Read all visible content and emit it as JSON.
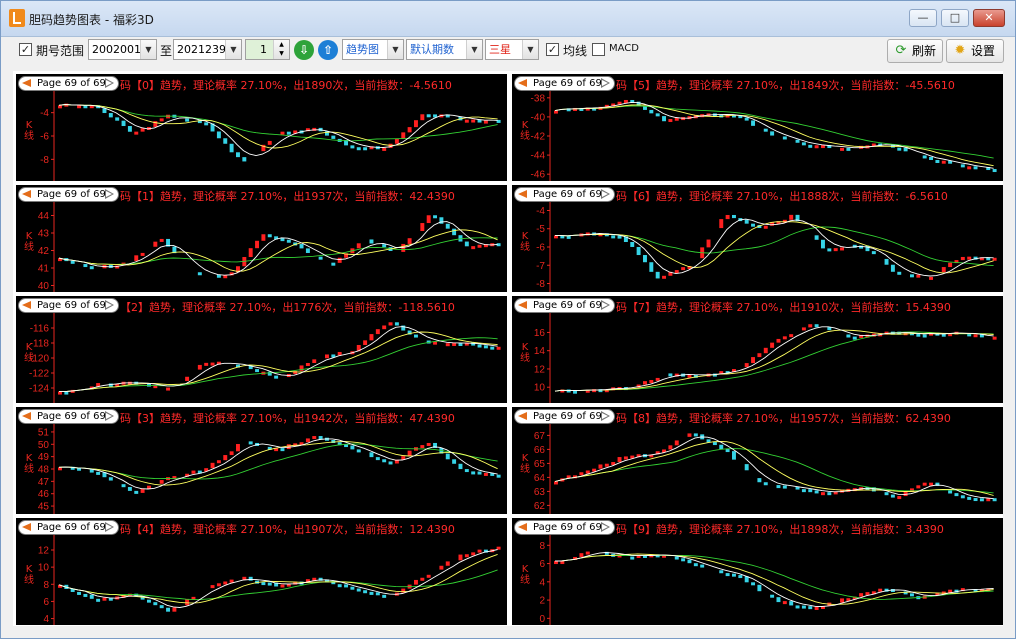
{
  "window": {
    "title": "胆码趋势图表 - 福彩3D",
    "min": "—",
    "max": "□",
    "close": "✕"
  },
  "toolbar": {
    "period_checkbox": "✓",
    "period_label": "期号范围",
    "from_value": "2002001",
    "to_label": "至",
    "to_value": "2021239",
    "step_value": "1",
    "chart_type": "趋势图",
    "period_mode": "默认期数",
    "lottery": "三星",
    "ma_checkbox": "✓",
    "ma_label": "均线",
    "macd_label": "MACD",
    "refresh_label": "刷新",
    "settings_label": "设置"
  },
  "colors": {
    "up": "#ff2020",
    "down": "#36d3e6",
    "ma5": "#ffffff",
    "ma10": "#ffff60",
    "ma20": "#33d033",
    "axis": "#e9261f"
  },
  "panels": [
    {
      "pager": "Page 69 of 69",
      "title": "码【0】趋势，理论概率 27.10%，出1890次，当前指数：-4.5610",
      "ylabel": "K线",
      "ticks": [
        "-4",
        "-6",
        "-8"
      ],
      "tickVals": [
        -4,
        -6,
        -8
      ],
      "ymin": -9.6,
      "ymax": -2.4,
      "start": -3.3,
      "end": -4.6,
      "mid": [
        -3.5,
        -5.8,
        -4.2,
        -5.0,
        -8.3,
        -5.6,
        -5.4,
        -7.0,
        -6.9,
        -4.0,
        -4.6
      ]
    },
    {
      "pager": "Page 69 of 69",
      "title": "码【5】趋势，理论概率 27.10%，出1849次，当前指数：-45.5610",
      "ylabel": "K线",
      "ticks": [
        "-38",
        "-40",
        "-42",
        "-44",
        "-46"
      ],
      "tickVals": [
        -38,
        -40,
        -42,
        -44,
        -46
      ],
      "ymin": -46.4,
      "ymax": -37.6,
      "start": -39.2,
      "end": -45.6,
      "mid": [
        -39.0,
        -38.3,
        -40.4,
        -39.6,
        -40.0,
        -42.0,
        -43.0,
        -43.2,
        -42.8,
        -44.2,
        -45.0
      ]
    },
    {
      "pager": "Page 69 of 69",
      "title": "码【1】趋势，理论概率 27.10%，出1937次，当前指数：42.4390",
      "ylabel": "K线",
      "ticks": [
        "44",
        "43",
        "42",
        "41",
        "40"
      ],
      "tickVals": [
        44,
        43,
        42,
        41,
        40
      ],
      "ymin": 39.8,
      "ymax": 44.6,
      "start": 41.5,
      "end": 42.4,
      "mid": [
        41.0,
        41.3,
        42.7,
        40.6,
        40.5,
        42.9,
        42.3,
        41.2,
        42.6,
        41.9,
        44.2,
        42.2
      ]
    },
    {
      "pager": "Page 69 of 69",
      "title": "码【6】趋势，理论概率 27.10%，出1888次，当前指数：-6.5610",
      "ylabel": "K线",
      "ticks": [
        "-4",
        "-5",
        "-6",
        "-7",
        "-8"
      ],
      "tickVals": [
        -4,
        -5,
        -6,
        -7,
        -8
      ],
      "ymin": -8.3,
      "ymax": -3.7,
      "start": -5.4,
      "end": -6.6,
      "mid": [
        -5.2,
        -5.5,
        -7.7,
        -7.0,
        -4.2,
        -4.9,
        -4.3,
        -6.2,
        -5.8,
        -7.3,
        -7.7,
        -6.5
      ]
    },
    {
      "pager": "Page 69 of 69",
      "title": "【2】趋势，理论概率 27.10%，出1776次，当前指数：-118.5610",
      "ylabel": "K线",
      "ticks": [
        "-116",
        "-118",
        "-120",
        "-122",
        "-124"
      ],
      "tickVals": [
        -116,
        -118,
        -120,
        -122,
        -124
      ],
      "ymin": -125.6,
      "ymax": -114.4,
      "start": -124.5,
      "end": -118.6,
      "mid": [
        -123.5,
        -123.2,
        -124.0,
        -120.5,
        -121.0,
        -122.8,
        -120.0,
        -119.0,
        -115.0,
        -118.0,
        -118.0
      ]
    },
    {
      "pager": "Page 69 of 69",
      "title": "码【7】趋势，理论概率 27.10%，出1910次，当前指数：15.4390",
      "ylabel": "K线",
      "ticks": [
        "16",
        "14",
        "12",
        "10"
      ],
      "tickVals": [
        16,
        14,
        12,
        10
      ],
      "ymin": 8.6,
      "ymax": 17.8,
      "start": 9.6,
      "end": 15.4,
      "mid": [
        9.7,
        10.0,
        11.5,
        11.3,
        12.0,
        15.0,
        17.0,
        15.5,
        16.0,
        15.8,
        16.0
      ]
    },
    {
      "pager": "Page 69 of 69",
      "title": "码【3】趋势，理论概率 27.10%，出1942次，当前指数：47.4390",
      "ylabel": "K线",
      "ticks": [
        "51",
        "50",
        "49",
        "48",
        "47",
        "46",
        "45"
      ],
      "tickVals": [
        51,
        50,
        49,
        48,
        47,
        46,
        45
      ],
      "ymin": 44.6,
      "ymax": 51.4,
      "start": 48.2,
      "end": 47.4,
      "mid": [
        47.8,
        46.0,
        47.3,
        48.0,
        50.2,
        49.6,
        50.7,
        49.7,
        48.4,
        50.2,
        48.0
      ]
    },
    {
      "pager": "Page 69 of 69",
      "title": "码【8】趋势，理论概率 27.10%，出1957次，当前指数：62.4390",
      "ylabel": "K线",
      "ticks": [
        "67",
        "66",
        "65",
        "64",
        "63",
        "62"
      ],
      "tickVals": [
        67,
        66,
        65,
        64,
        63,
        62
      ],
      "ymin": 61.6,
      "ymax": 67.6,
      "start": 63.8,
      "end": 62.4,
      "mid": [
        64.5,
        65.5,
        65.8,
        67.2,
        66.0,
        63.6,
        63.3,
        62.8,
        63.4,
        62.5,
        63.7,
        62.6
      ]
    },
    {
      "pager": "Page 69 of 69",
      "title": "码【4】趋势，理论概率 27.10%，出1907次，当前指数：12.4390",
      "ylabel": "K线",
      "ticks": [
        "12",
        "10",
        "8",
        "6",
        "4"
      ],
      "tickVals": [
        12,
        10,
        8,
        6,
        4
      ],
      "ymin": 3.6,
      "ymax": 13.4,
      "start": 7.8,
      "end": 12.4,
      "mid": [
        6.2,
        6.8,
        4.8,
        7.7,
        8.8,
        7.8,
        8.7,
        7.4,
        6.6,
        9.0,
        11.5
      ]
    },
    {
      "pager": "Page 69 of 69",
      "title": "码【9】趋势，理论概率 27.10%，出1898次，当前指数：3.4390",
      "ylabel": "K线",
      "ticks": [
        "8",
        "6",
        "4",
        "2",
        "0"
      ],
      "tickVals": [
        8,
        6,
        4,
        2,
        0
      ],
      "ymin": -0.4,
      "ymax": 8.8,
      "start": 6.2,
      "end": 3.4,
      "mid": [
        7.4,
        6.7,
        7.0,
        5.5,
        4.6,
        2.0,
        1.0,
        2.3,
        3.4,
        2.3,
        3.2
      ]
    }
  ]
}
